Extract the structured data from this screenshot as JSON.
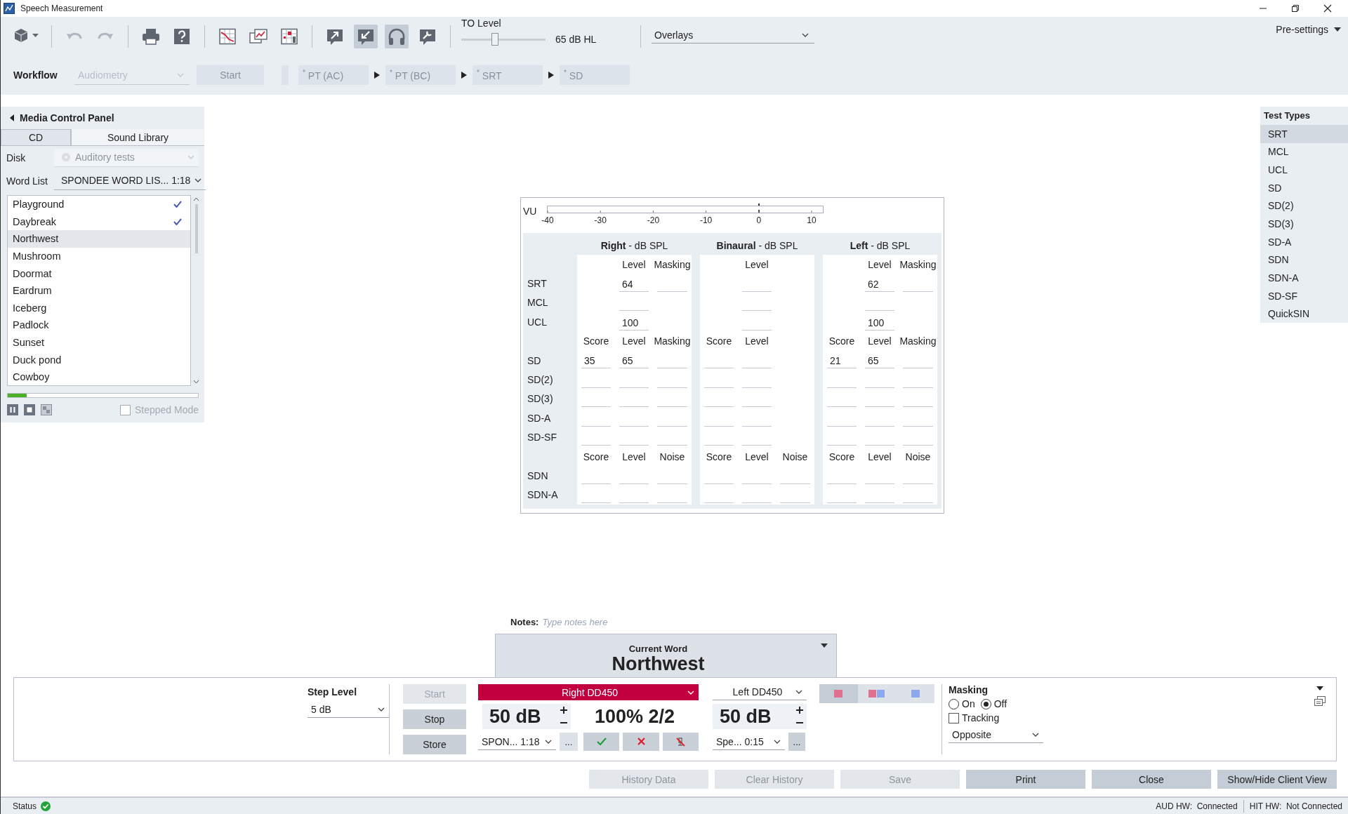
{
  "window": {
    "title": "Speech Measurement"
  },
  "toolbar": {
    "groups": [
      {
        "buttons": [
          {
            "kind": "cube-menu",
            "on": false,
            "disabled": false
          }
        ]
      },
      {
        "buttons": [
          {
            "kind": "undo",
            "on": false,
            "disabled": true
          },
          {
            "kind": "redo",
            "on": false,
            "disabled": true
          }
        ]
      },
      {
        "buttons": [
          {
            "kind": "print",
            "on": false,
            "disabled": false
          },
          {
            "kind": "help",
            "on": false,
            "disabled": false
          }
        ]
      },
      {
        "buttons": [
          {
            "kind": "graph",
            "on": false,
            "disabled": false
          },
          {
            "kind": "graph-overlay",
            "on": false,
            "disabled": false
          },
          {
            "kind": "graph-points",
            "on": false,
            "disabled": false
          }
        ]
      },
      {
        "buttons": [
          {
            "kind": "export",
            "on": false,
            "disabled": false
          },
          {
            "kind": "import",
            "on": true,
            "disabled": false
          },
          {
            "kind": "headphones",
            "on": true,
            "disabled": false
          },
          {
            "kind": "wrench",
            "on": false,
            "disabled": false
          }
        ]
      }
    ],
    "to_level": {
      "label": "TO Level",
      "level": 0.4,
      "reading": "65 dB HL"
    },
    "overlays": {
      "value": "Overlays"
    },
    "pre_settings": "Pre-settings"
  },
  "workflow": {
    "label": "Workflow",
    "protocol": {
      "value": "Audiometry",
      "disabled": true
    },
    "start": {
      "label": "Start",
      "disabled": true
    },
    "steps": [
      {
        "label": "$^{*}$ PT (AC)"
      },
      {
        "label": "$^{*}$ PT (BC)"
      },
      {
        "label": "$^{*}$ SRT"
      },
      {
        "label": "$^{*}$ SD"
      }
    ]
  },
  "media_panel": {
    "title": "Media Control Panel",
    "tabs": [
      {
        "label": "CD",
        "selected": true
      },
      {
        "label": "Sound Library",
        "selected": false
      }
    ],
    "disk": {
      "label": "Disk",
      "value": "Auditory tests",
      "disabled": true
    },
    "word_list": {
      "label": "Word List",
      "value": "SPONDEE WORD LIS... 1:18"
    },
    "words": [
      {
        "text": "Playground",
        "checked": true,
        "selected": false
      },
      {
        "text": "Daybreak",
        "checked": true,
        "selected": false
      },
      {
        "text": "Northwest",
        "checked": false,
        "selected": true
      },
      {
        "text": "Mushroom",
        "checked": false,
        "selected": false
      },
      {
        "text": "Doormat",
        "checked": false,
        "selected": false
      },
      {
        "text": "Eardrum",
        "checked": false,
        "selected": false
      },
      {
        "text": "Iceberg",
        "checked": false,
        "selected": false
      },
      {
        "text": "Padlock",
        "checked": false,
        "selected": false
      },
      {
        "text": "Sunset",
        "checked": false,
        "selected": false
      },
      {
        "text": "Duck pond",
        "checked": false,
        "selected": false
      },
      {
        "text": "Cowboy",
        "checked": false,
        "selected": false
      }
    ],
    "progress": {
      "level": 0.1
    },
    "stepped_mode": {
      "label": "Stepped Mode",
      "checked": false,
      "disabled": true
    }
  },
  "results": {
    "vu": {
      "label": "VU",
      "ticks": [
        "-40",
        "-30",
        "-20",
        "-10",
        "0",
        "10"
      ]
    },
    "sections": [
      {
        "title": "Right",
        "unit": "- dB SPL"
      },
      {
        "title": "Binaural",
        "unit": "- dB SPL"
      },
      {
        "title": "Left",
        "unit": "- dB SPL"
      }
    ],
    "blocks": [
      {
        "headers": [
          {
            "column_2": "Level",
            "column_3": "Masking"
          },
          {
            "column_2": "Level"
          },
          {
            "column_2": "Level",
            "column_3": "Masking"
          }
        ],
        "rows": [
          {
            "label": "SRT",
            "cells": [
              [
                {
                  "kind": "blank"
                },
                {
                  "kind": "field",
                  "value": "64"
                },
                {
                  "kind": "field"
                }
              ],
              [
                {
                  "kind": "blank"
                },
                {
                  "kind": "field"
                },
                {
                  "kind": "blank"
                }
              ],
              [
                {
                  "kind": "blank"
                },
                {
                  "kind": "field",
                  "value": "62"
                },
                {
                  "kind": "field"
                }
              ]
            ]
          },
          {
            "label": "MCL",
            "cells": [
              [
                {
                  "kind": "blank"
                },
                {
                  "kind": "field"
                },
                {
                  "kind": "blank"
                }
              ],
              [
                {
                  "kind": "blank"
                },
                {
                  "kind": "field"
                },
                {
                  "kind": "blank"
                }
              ],
              [
                {
                  "kind": "blank"
                },
                {
                  "kind": "field"
                },
                {
                  "kind": "blank"
                }
              ]
            ]
          },
          {
            "label": "UCL",
            "cells": [
              [
                {
                  "kind": "blank"
                },
                {
                  "kind": "field",
                  "value": "100"
                },
                {
                  "kind": "blank"
                }
              ],
              [
                {
                  "kind": "blank"
                },
                {
                  "kind": "field"
                },
                {
                  "kind": "blank"
                }
              ],
              [
                {
                  "kind": "blank"
                },
                {
                  "kind": "field",
                  "value": "100"
                },
                {
                  "kind": "blank"
                }
              ]
            ]
          }
        ]
      },
      {
        "headers": [
          {
            "column_1": "Score",
            "column_2": "Level",
            "column_3": "Masking"
          },
          {
            "column_1": "Score",
            "column_2": "Level"
          },
          {
            "column_1": "Score",
            "column_2": "Level",
            "column_3": "Masking"
          }
        ],
        "rows": [
          {
            "label": "SD",
            "cells": [
              [
                {
                  "kind": "field",
                  "value": "35"
                },
                {
                  "kind": "field",
                  "value": "65"
                },
                {
                  "kind": "field"
                }
              ],
              [
                {
                  "kind": "field"
                },
                {
                  "kind": "field"
                },
                {
                  "kind": "blank"
                }
              ],
              [
                {
                  "kind": "field",
                  "value": "21"
                },
                {
                  "kind": "field",
                  "value": "65"
                },
                {
                  "kind": "field"
                }
              ]
            ]
          },
          {
            "label": "SD(2)",
            "cells": [
              [
                {
                  "kind": "field"
                },
                {
                  "kind": "field"
                },
                {
                  "kind": "field"
                }
              ],
              [
                {
                  "kind": "field"
                },
                {
                  "kind": "field"
                },
                {
                  "kind": "blank"
                }
              ],
              [
                {
                  "kind": "field"
                },
                {
                  "kind": "field"
                },
                {
                  "kind": "field"
                }
              ]
            ]
          },
          {
            "label": "SD(3)",
            "cells": [
              [
                {
                  "kind": "field"
                },
                {
                  "kind": "field"
                },
                {
                  "kind": "field"
                }
              ],
              [
                {
                  "kind": "field"
                },
                {
                  "kind": "field"
                },
                {
                  "kind": "blank"
                }
              ],
              [
                {
                  "kind": "field"
                },
                {
                  "kind": "field"
                },
                {
                  "kind": "field"
                }
              ]
            ]
          },
          {
            "label": "SD-A",
            "cells": [
              [
                {
                  "kind": "field"
                },
                {
                  "kind": "field"
                },
                {
                  "kind": "field"
                }
              ],
              [
                {
                  "kind": "field"
                },
                {
                  "kind": "field"
                },
                {
                  "kind": "blank"
                }
              ],
              [
                {
                  "kind": "field"
                },
                {
                  "kind": "field"
                },
                {
                  "kind": "field"
                }
              ]
            ]
          },
          {
            "label": "SD-SF",
            "cells": [
              [
                {
                  "kind": "field"
                },
                {
                  "kind": "field"
                },
                {
                  "kind": "field"
                }
              ],
              [
                {
                  "kind": "field"
                },
                {
                  "kind": "field"
                },
                {
                  "kind": "blank"
                }
              ],
              [
                {
                  "kind": "field"
                },
                {
                  "kind": "field"
                },
                {
                  "kind": "field"
                }
              ]
            ]
          }
        ]
      },
      {
        "headers": [
          {
            "column_1": "Score",
            "column_2": "Level",
            "column_3": "Noise"
          },
          {
            "column_1": "Score",
            "column_2": "Level",
            "column_3": "Noise"
          },
          {
            "column_1": "Score",
            "column_2": "Level",
            "column_3": "Noise"
          }
        ],
        "rows": [
          {
            "label": "SDN",
            "cells": [
              [
                {
                  "kind": "field"
                },
                {
                  "kind": "field"
                },
                {
                  "kind": "field"
                }
              ],
              [
                {
                  "kind": "field"
                },
                {
                  "kind": "field"
                },
                {
                  "kind": "field"
                }
              ],
              [
                {
                  "kind": "field"
                },
                {
                  "kind": "field"
                },
                {
                  "kind": "field"
                }
              ]
            ]
          },
          {
            "label": "SDN-A",
            "cells": [
              [
                {
                  "kind": "field"
                },
                {
                  "kind": "field"
                },
                {
                  "kind": "field"
                }
              ],
              [
                {
                  "kind": "field"
                },
                {
                  "kind": "field"
                },
                {
                  "kind": "field"
                }
              ],
              [
                {
                  "kind": "field"
                },
                {
                  "kind": "field"
                },
                {
                  "kind": "field"
                }
              ]
            ]
          }
        ]
      }
    ]
  },
  "test_types": {
    "title": "Test Types",
    "items": [
      {
        "label": "SRT",
        "selected": true
      },
      {
        "label": "MCL",
        "selected": false
      },
      {
        "label": "UCL",
        "selected": false
      },
      {
        "label": "SD",
        "selected": false
      },
      {
        "label": "SD(2)",
        "selected": false
      },
      {
        "label": "SD(3)",
        "selected": false
      },
      {
        "label": "SD-A",
        "selected": false
      },
      {
        "label": "SDN",
        "selected": false
      },
      {
        "label": "SDN-A",
        "selected": false
      },
      {
        "label": "SD-SF",
        "selected": false
      },
      {
        "label": "QuickSIN",
        "selected": false
      }
    ]
  },
  "notes": {
    "label": "Notes:",
    "placeholder": "Type notes here"
  },
  "current_word": {
    "label": "Current Word",
    "word": "Northwest"
  },
  "control": {
    "step_level": {
      "label": "Step Level",
      "value": "5 dB"
    },
    "buttons": [
      {
        "label": "Start",
        "disabled": true
      },
      {
        "label": "Stop",
        "disabled": false
      },
      {
        "label": "Store",
        "disabled": false
      }
    ],
    "right": {
      "kind": "right",
      "channel": "Right DD450",
      "level": "50 dB",
      "score": "100% 2/2",
      "list": "SPON... 1:18",
      "more": "..."
    },
    "responses": [
      {
        "kind": "correct"
      },
      {
        "kind": "incorrect"
      },
      {
        "kind": "no-response"
      }
    ],
    "left": {
      "kind": "left",
      "channel": "Left DD450",
      "level": "50 dB",
      "list": "Spe... 0:15",
      "more": "..."
    },
    "routing": [
      {
        "kind": "right",
        "selected": true
      },
      {
        "kind": "binaural",
        "selected": false
      },
      {
        "kind": "left",
        "selected": false
      }
    ],
    "masking": {
      "label": "Masking",
      "options": [
        {
          "label": "On",
          "selected": false
        },
        {
          "label": "Off",
          "selected": true
        }
      ],
      "tracking": {
        "label": "Tracking",
        "checked": false
      },
      "mode": "Opposite"
    }
  },
  "actions": [
    {
      "label": "History Data",
      "disabled": true
    },
    {
      "label": "Clear History",
      "disabled": true
    },
    {
      "label": "Save",
      "disabled": true
    },
    {
      "label": "Print",
      "disabled": false
    },
    {
      "label": "Close",
      "disabled": false
    },
    {
      "label": "Show/Hide Client View",
      "disabled": false
    }
  ],
  "status_bar": {
    "label": "Status",
    "ok": true,
    "hardware": [
      "AUD HW:  Connected",
      "HIT HW:  Not Connected"
    ]
  }
}
